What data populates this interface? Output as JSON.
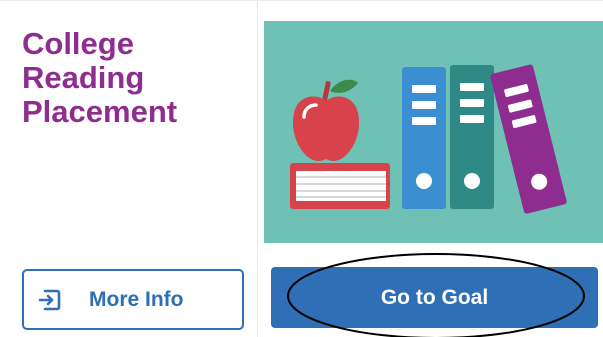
{
  "card": {
    "title_lines": [
      "College",
      "Reading",
      "Placement"
    ],
    "more_info_label": "More Info",
    "more_info_icon": "sign-in-icon",
    "go_to_goal_label": "Go to Goal"
  },
  "illustration": {
    "subject": "apple-on-book-and-binders",
    "background_color": "#6fc1b6",
    "apple_color": "#d8424a",
    "book_color": "#d8424a",
    "binder_colors": [
      "#3b8fd0",
      "#2f8a86",
      "#8e2d8f"
    ]
  },
  "colors": {
    "title": "#8e2d8f",
    "primary_button": "#2f6fb5",
    "annotation_stroke": "#000000"
  }
}
